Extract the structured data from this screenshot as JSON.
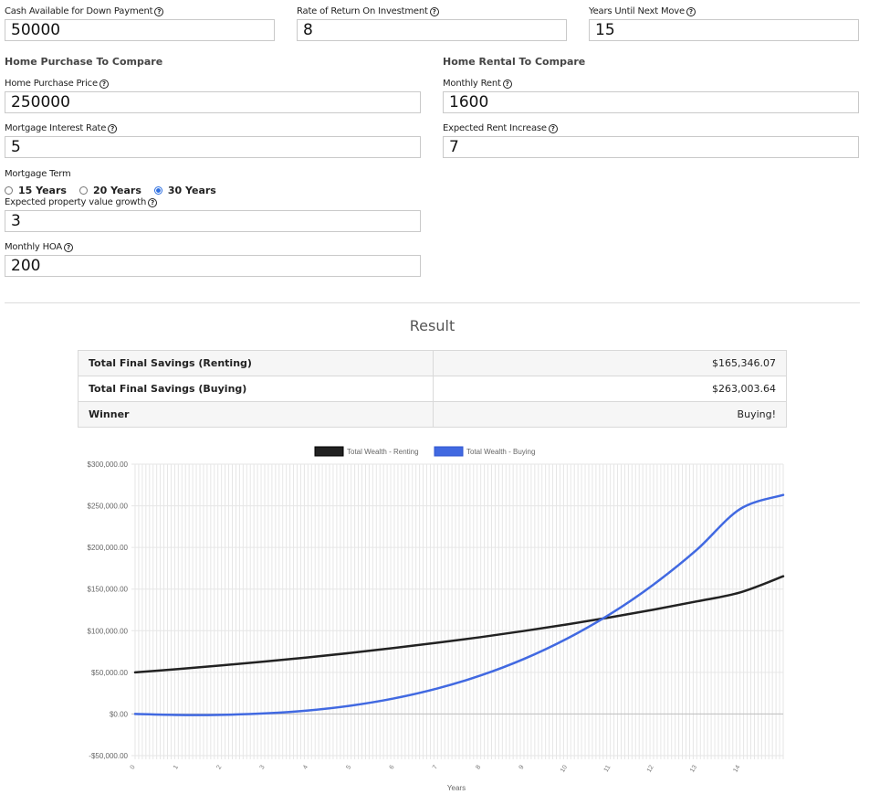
{
  "inputs": {
    "cash_down": {
      "label": "Cash Available for Down Payment",
      "value": "50000"
    },
    "rate_of_return": {
      "label": "Rate of Return On Investment",
      "value": "8"
    },
    "years_until_move": {
      "label": "Years Until Next Move",
      "value": "15"
    }
  },
  "purchase": {
    "title": "Home Purchase To Compare",
    "price": {
      "label": "Home Purchase Price",
      "value": "250000"
    },
    "interest": {
      "label": "Mortgage Interest Rate",
      "value": "5"
    },
    "term": {
      "label": "Mortgage Term",
      "options": [
        "15 Years",
        "20 Years",
        "30 Years"
      ],
      "selected": "30 Years"
    },
    "growth": {
      "label": "Expected property value growth",
      "value": "3"
    },
    "hoa": {
      "label": "Monthly HOA",
      "value": "200"
    }
  },
  "rental": {
    "title": "Home Rental To Compare",
    "rent": {
      "label": "Monthly Rent",
      "value": "1600"
    },
    "increase": {
      "label": "Expected Rent Increase",
      "value": "7"
    }
  },
  "result": {
    "title": "Result",
    "rows": [
      {
        "key": "Total Final Savings (Renting)",
        "value": "$165,346.07"
      },
      {
        "key": "Total Final Savings (Buying)",
        "value": "$263,003.64"
      },
      {
        "key": "Winner",
        "value": "Buying!"
      }
    ]
  },
  "help_glyph": "?",
  "chart_data": {
    "type": "line",
    "xlabel": "Years",
    "ylabel": "",
    "ylim": [
      -50000,
      300000
    ],
    "yticks": [
      "$300,000.00",
      "$250,000.00",
      "$200,000.00",
      "$150,000.00",
      "$100,000.00",
      "$50,000.00",
      "$0.00",
      "-$50,000.00"
    ],
    "xticks": [
      "0",
      "1",
      "2",
      "3",
      "4",
      "5",
      "6",
      "7",
      "8",
      "9",
      "10",
      "11",
      "12",
      "13",
      "14"
    ],
    "grid": true,
    "legend_position": "top",
    "series": [
      {
        "name": "Total Wealth - Renting",
        "color": "#222222",
        "x": [
          0,
          1,
          2,
          3,
          4,
          5,
          6,
          7,
          8,
          9,
          10,
          11,
          12,
          13,
          14,
          15
        ],
        "values": [
          50000,
          54000,
          58300,
          63000,
          68000,
          73400,
          79300,
          85600,
          92300,
          99700,
          107600,
          116100,
          125300,
          135200,
          145900,
          165346
        ]
      },
      {
        "name": "Total Wealth - Buying",
        "color": "#4169e1",
        "x": [
          0,
          1,
          2,
          3,
          4,
          5,
          6,
          7,
          8,
          9,
          10,
          11,
          12,
          13,
          14,
          15
        ],
        "values": [
          0,
          -1200,
          -1000,
          700,
          4200,
          10100,
          18800,
          30700,
          46300,
          66100,
          90600,
          120100,
          155500,
          197200,
          246000,
          263004
        ]
      }
    ]
  }
}
